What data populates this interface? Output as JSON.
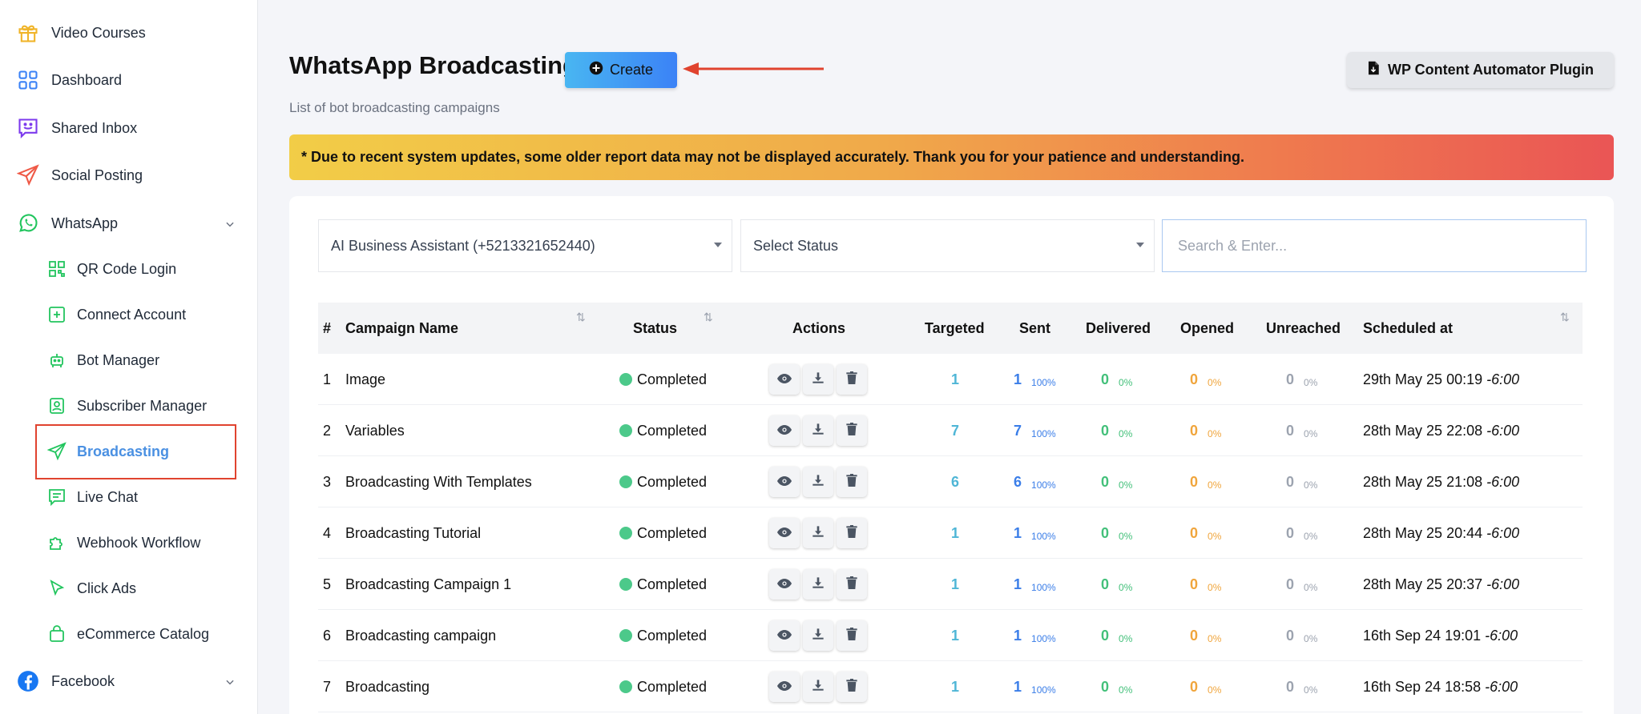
{
  "sidebar": {
    "items": [
      {
        "label": "Video Courses",
        "icon": "gift-icon",
        "level": "top"
      },
      {
        "label": "Dashboard",
        "icon": "grid-icon",
        "level": "top"
      },
      {
        "label": "Shared Inbox",
        "icon": "chat-smile-icon",
        "level": "top"
      },
      {
        "label": "Social Posting",
        "icon": "paper-plane-icon",
        "level": "top"
      },
      {
        "label": "WhatsApp",
        "icon": "whatsapp-icon",
        "level": "top",
        "expanded": true
      },
      {
        "label": "QR Code Login",
        "icon": "qr-code-icon",
        "level": "sub"
      },
      {
        "label": "Connect Account",
        "icon": "plus-square-icon",
        "level": "sub"
      },
      {
        "label": "Bot Manager",
        "icon": "robot-icon",
        "level": "sub"
      },
      {
        "label": "Subscriber Manager",
        "icon": "contact-card-icon",
        "level": "sub"
      },
      {
        "label": "Broadcasting",
        "icon": "paper-plane-icon",
        "level": "sub",
        "active": true
      },
      {
        "label": "Live Chat",
        "icon": "chat-icon",
        "level": "sub"
      },
      {
        "label": "Webhook Workflow",
        "icon": "puzzle-icon",
        "level": "sub"
      },
      {
        "label": "Click Ads",
        "icon": "cursor-icon",
        "level": "sub"
      },
      {
        "label": "eCommerce Catalog",
        "icon": "shopping-bag-icon",
        "level": "sub"
      },
      {
        "label": "Facebook",
        "icon": "facebook-icon",
        "level": "top"
      }
    ]
  },
  "header": {
    "title": "WhatsApp Broadcasting",
    "create_label": "Create",
    "subtitle": "List of bot broadcasting campaigns",
    "plugin_label": "WP Content Automator Plugin"
  },
  "notice": "* Due to recent system updates, some older report data may not be displayed accurately. Thank you for your patience and understanding.",
  "filters": {
    "account": "AI Business Assistant (+5213321652440)",
    "status": "Select Status",
    "search_placeholder": "Search & Enter..."
  },
  "table": {
    "columns": [
      "#",
      "Campaign Name",
      "Status",
      "Actions",
      "Targeted",
      "Sent",
      "Delivered",
      "Opened",
      "Unreached",
      "Scheduled at"
    ],
    "rows": [
      {
        "n": "1",
        "name": "Image",
        "status": "Completed",
        "targeted": "1",
        "sent": "1",
        "sent_pct": "100%",
        "delivered": "0",
        "delivered_pct": "0%",
        "opened": "0",
        "opened_pct": "0%",
        "unreached": "0",
        "unreached_pct": "0%",
        "scheduled": "29th May 25 00:19",
        "tz": "-6:00"
      },
      {
        "n": "2",
        "name": "Variables",
        "status": "Completed",
        "targeted": "7",
        "sent": "7",
        "sent_pct": "100%",
        "delivered": "0",
        "delivered_pct": "0%",
        "opened": "0",
        "opened_pct": "0%",
        "unreached": "0",
        "unreached_pct": "0%",
        "scheduled": "28th May 25 22:08",
        "tz": "-6:00"
      },
      {
        "n": "3",
        "name": "Broadcasting With Templates",
        "status": "Completed",
        "targeted": "6",
        "sent": "6",
        "sent_pct": "100%",
        "delivered": "0",
        "delivered_pct": "0%",
        "opened": "0",
        "opened_pct": "0%",
        "unreached": "0",
        "unreached_pct": "0%",
        "scheduled": "28th May 25 21:08",
        "tz": "-6:00"
      },
      {
        "n": "4",
        "name": "Broadcasting Tutorial",
        "status": "Completed",
        "targeted": "1",
        "sent": "1",
        "sent_pct": "100%",
        "delivered": "0",
        "delivered_pct": "0%",
        "opened": "0",
        "opened_pct": "0%",
        "unreached": "0",
        "unreached_pct": "0%",
        "scheduled": "28th May 25 20:44",
        "tz": "-6:00"
      },
      {
        "n": "5",
        "name": "Broadcasting Campaign 1",
        "status": "Completed",
        "targeted": "1",
        "sent": "1",
        "sent_pct": "100%",
        "delivered": "0",
        "delivered_pct": "0%",
        "opened": "0",
        "opened_pct": "0%",
        "unreached": "0",
        "unreached_pct": "0%",
        "scheduled": "28th May 25 20:37",
        "tz": "-6:00"
      },
      {
        "n": "6",
        "name": "Broadcasting campaign",
        "status": "Completed",
        "targeted": "1",
        "sent": "1",
        "sent_pct": "100%",
        "delivered": "0",
        "delivered_pct": "0%",
        "opened": "0",
        "opened_pct": "0%",
        "unreached": "0",
        "unreached_pct": "0%",
        "scheduled": "16th Sep 24 19:01",
        "tz": "-6:00"
      },
      {
        "n": "7",
        "name": "Broadcasting",
        "status": "Completed",
        "targeted": "1",
        "sent": "1",
        "sent_pct": "100%",
        "delivered": "0",
        "delivered_pct": "0%",
        "opened": "0",
        "opened_pct": "0%",
        "unreached": "0",
        "unreached_pct": "0%",
        "scheduled": "16th Sep 24 18:58",
        "tz": "-6:00"
      }
    ]
  },
  "colors": {
    "accent": "#4a90e2",
    "annotation": "#e0432f",
    "status_completed": "#4cc98a"
  }
}
